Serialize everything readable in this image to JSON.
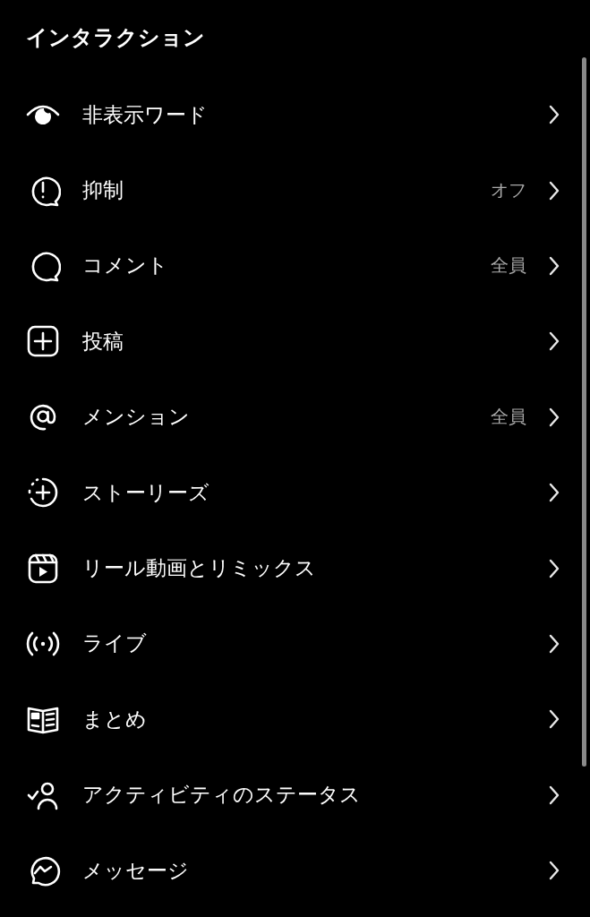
{
  "section_title": "インタラクション",
  "items": [
    {
      "label": "非表示ワード"
    },
    {
      "label": "抑制",
      "value": "オフ"
    },
    {
      "label": "コメント",
      "value": "全員"
    },
    {
      "label": "投稿"
    },
    {
      "label": "メンション",
      "value": "全員"
    },
    {
      "label": "ストーリーズ"
    },
    {
      "label": "リール動画とリミックス"
    },
    {
      "label": "ライブ"
    },
    {
      "label": "まとめ"
    },
    {
      "label": "アクティビティのステータス"
    },
    {
      "label": "メッセージ"
    }
  ]
}
